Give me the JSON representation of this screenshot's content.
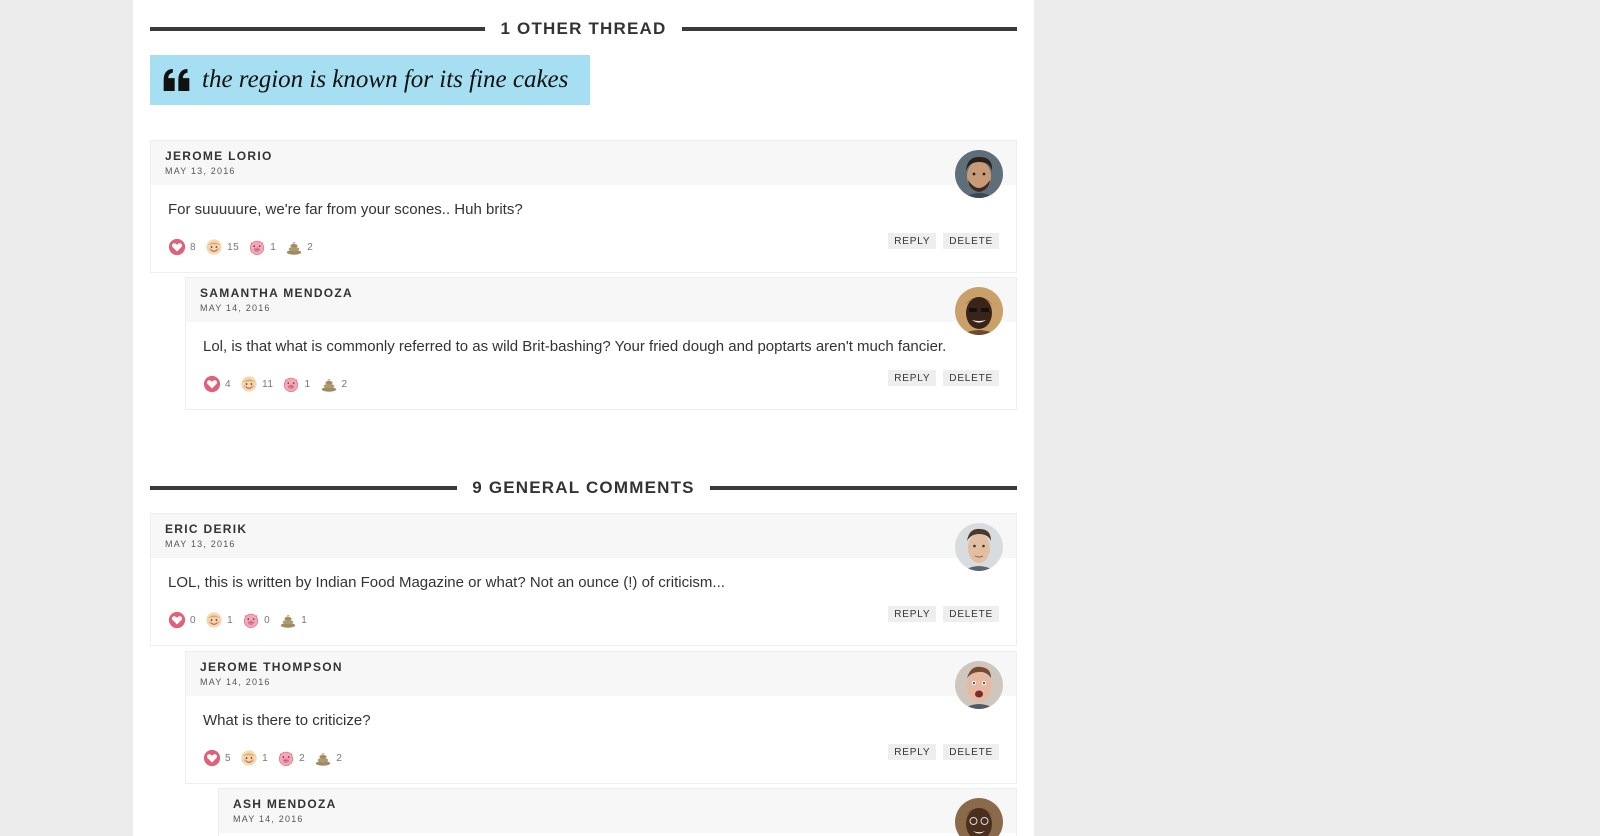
{
  "threads_header": {
    "title": "1 OTHER THREAD"
  },
  "quote": {
    "icon": "quote-icon",
    "text": "the region is known for its fine cakes"
  },
  "general_header": {
    "title": "9 GENERAL COMMENTS"
  },
  "buttons": {
    "reply": "REPLY",
    "delete": "DELETE"
  },
  "colors": {
    "quote_bg": "#a6dff1",
    "heart": "#e0627a",
    "cake": "#f2d9b0",
    "pig": "#f4a7b6",
    "poop": "#a08a62"
  },
  "comments": [
    {
      "author": "JEROME LORIO",
      "date": "MAY 13, 2016",
      "text": "For suuuuure, we're far from your scones.. Huh brits?",
      "reactions": {
        "heart": "8",
        "cake": "15",
        "pig": "1",
        "poop": "2"
      }
    },
    {
      "author": "SAMANTHA MENDOZA",
      "date": "MAY 14, 2016",
      "text": "Lol, is that what is commonly referred to as wild Brit-bashing? Your fried dough and poptarts aren't much fancier.",
      "reactions": {
        "heart": "4",
        "cake": "11",
        "pig": "1",
        "poop": "2"
      }
    },
    {
      "author": "ERIC DERIK",
      "date": "MAY 13, 2016",
      "text": "LOL, this is written by Indian Food Magazine or what? Not an ounce (!) of criticism...",
      "reactions": {
        "heart": "0",
        "cake": "1",
        "pig": "0",
        "poop": "1"
      }
    },
    {
      "author": "JEROME THOMPSON",
      "date": "MAY 14, 2016",
      "text": "What is there to criticize?",
      "reactions": {
        "heart": "5",
        "cake": "1",
        "pig": "2",
        "poop": "2"
      }
    },
    {
      "author": "ASH MENDOZA",
      "date": "MAY 14, 2016"
    }
  ]
}
